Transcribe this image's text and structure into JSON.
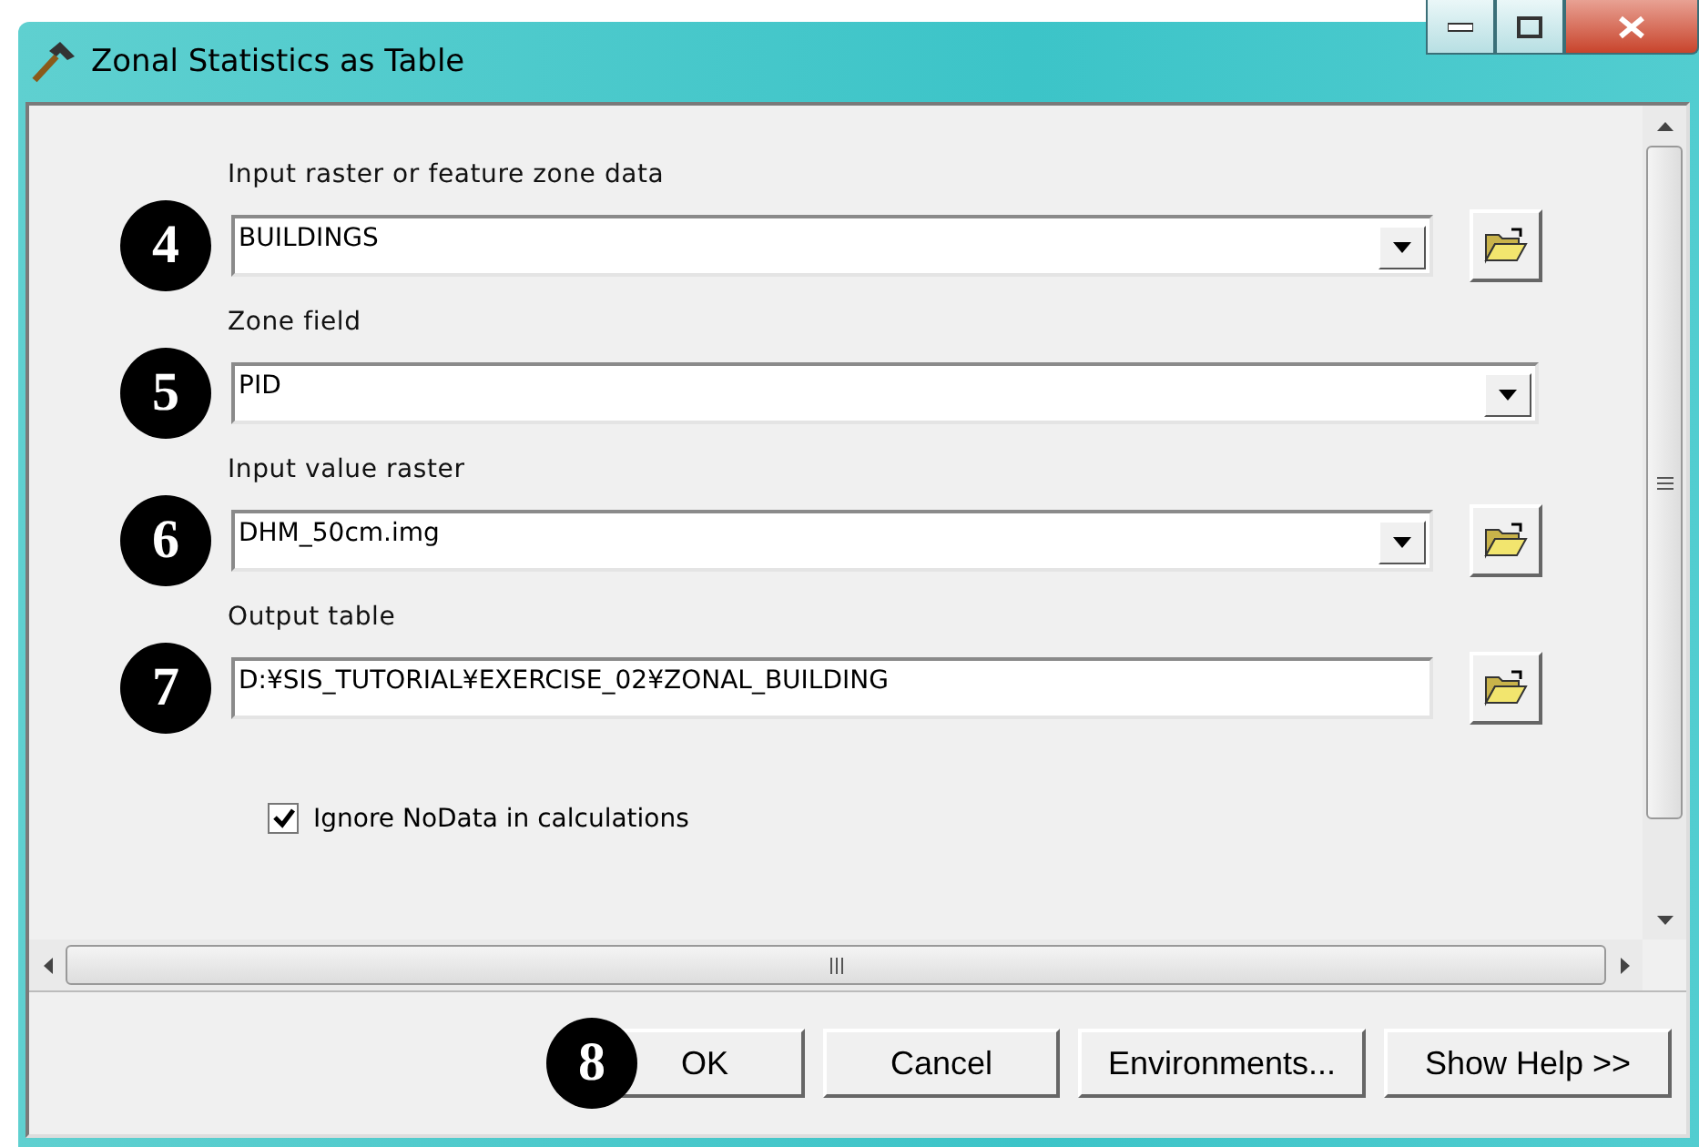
{
  "window": {
    "title": "Zonal Statistics as Table"
  },
  "parameters": [
    {
      "marker": "4",
      "label": "Input raster or feature zone data",
      "value": "BUILDINGS",
      "kind": "combo",
      "browse": true
    },
    {
      "marker": "5",
      "label": "Zone field",
      "value": "PID",
      "kind": "combo",
      "browse": false
    },
    {
      "marker": "6",
      "label": "Input value raster",
      "value": "DHM_50cm.img",
      "kind": "combo",
      "browse": true
    },
    {
      "marker": "7",
      "label": "Output table",
      "value": "D:¥SIS_TUTORIAL¥EXERCISE_02¥ZONAL_BUILDING",
      "kind": "text",
      "browse": true
    }
  ],
  "checkbox": {
    "label": "Ignore NoData in calculations",
    "checked": true
  },
  "buttons": [
    {
      "label": "OK",
      "marker": "8"
    },
    {
      "label": "Cancel"
    },
    {
      "label": "Environments..."
    },
    {
      "label": "Show Help >>"
    }
  ]
}
